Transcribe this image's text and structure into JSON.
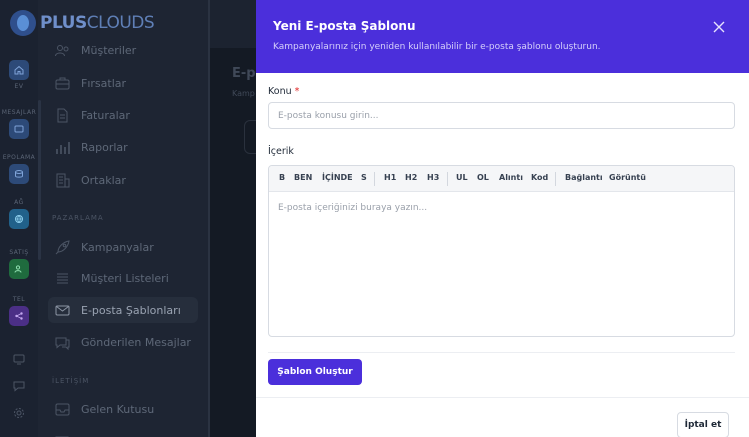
{
  "app": {
    "logo_prefix": "PLUS",
    "logo_suffix": "CLOUDS"
  },
  "rail": {
    "items": [
      {
        "label": "EV",
        "icon": "home-icon",
        "color": "#2d4a78"
      },
      {
        "label": "MESAJLAR",
        "icon": "inbox-icon",
        "color": "#2d4a78"
      },
      {
        "label": "EPOLAMA",
        "icon": "database-icon",
        "color": "#2d4a78"
      },
      {
        "label": "AĞ",
        "icon": "globe-icon",
        "color": "#21618a"
      },
      {
        "label": "SATIŞ",
        "icon": "users-icon",
        "color": "#1f6b3e"
      },
      {
        "label": "TEL",
        "icon": "share-icon",
        "color": "#4b2f86"
      }
    ]
  },
  "sidebar": {
    "items_top": [
      "Müşteriler",
      "Fırsatlar",
      "Faturalar",
      "Raporlar",
      "Ortaklar"
    ],
    "section_marketing": "PAZARLAMA",
    "items_marketing": [
      "Kampanyalar",
      "Müşteri Listeleri",
      "E-posta Şablonları",
      "Gönderilen Mesajlar"
    ],
    "section_comm": "İLETİŞİM",
    "items_comm": [
      "Gelen Kutusu"
    ]
  },
  "main": {
    "title": "E-p",
    "subtitle": "Kamp"
  },
  "drawer": {
    "title": "Yeni E-posta Şablonu",
    "subtitle": "Kampanyalarınız için yeniden kullanılabilir bir e-posta şablonu oluşturun.",
    "subject_label": "Konu",
    "subject_required": "*",
    "subject_placeholder": "E-posta konusu girin...",
    "content_label": "İçerik",
    "toolbar": {
      "bold": "B",
      "italic": "BEN",
      "inline": "İÇİNDE",
      "strike": "S",
      "h1": "H1",
      "h2": "H2",
      "h3": "H3",
      "ul": "UL",
      "ol": "OL",
      "quote": "Alıntı",
      "code": "Kod",
      "link": "Bağlantı",
      "image": "Görüntü"
    },
    "editor_placeholder": "E-posta içeriğinizi buraya yazın...",
    "create_button": "Şablon Oluştur",
    "cancel_button": "İptal et"
  },
  "colors": {
    "accent": "#4b2fdb",
    "required": "#e02424"
  }
}
